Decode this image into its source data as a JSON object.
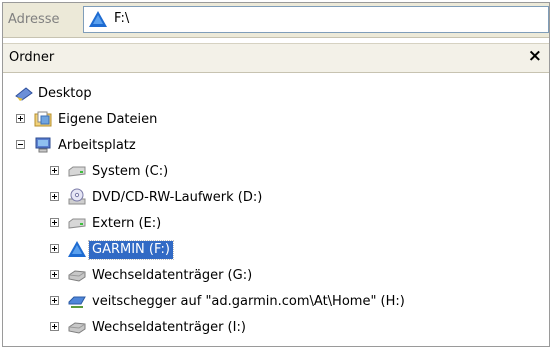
{
  "address_bar": {
    "label": "Adresse",
    "value": "F:\\",
    "icon": "garmin-drive-icon"
  },
  "folder_pane": {
    "title": "Ordner",
    "close_label": "×"
  },
  "tree": {
    "desktop": {
      "label": "Desktop",
      "icon": "desktop-icon"
    },
    "eigene_dateien": {
      "label": "Eigene Dateien",
      "icon": "documents-folder-icon"
    },
    "arbeitsplatz": {
      "label": "Arbeitsplatz",
      "icon": "my-computer-icon"
    },
    "drives": [
      {
        "label": "System (C:)",
        "icon": "hard-drive-icon"
      },
      {
        "label": "DVD/CD-RW-Laufwerk (D:)",
        "icon": "dvd-drive-icon"
      },
      {
        "label": "Extern (E:)",
        "icon": "hard-drive-icon"
      },
      {
        "label": "GARMIN (F:)",
        "icon": "garmin-drive-icon",
        "selected": true
      },
      {
        "label": "Wechseldatenträger (G:)",
        "icon": "removable-drive-icon"
      },
      {
        "label": "veitschegger auf \"ad.garmin.com\\At\\Home\" (H:)",
        "icon": "network-drive-icon"
      },
      {
        "label": "Wechseldatenträger (I:)",
        "icon": "removable-drive-icon"
      }
    ]
  },
  "colors": {
    "selection": "#316ac5",
    "toolbar_bg": "#ece9d8"
  }
}
